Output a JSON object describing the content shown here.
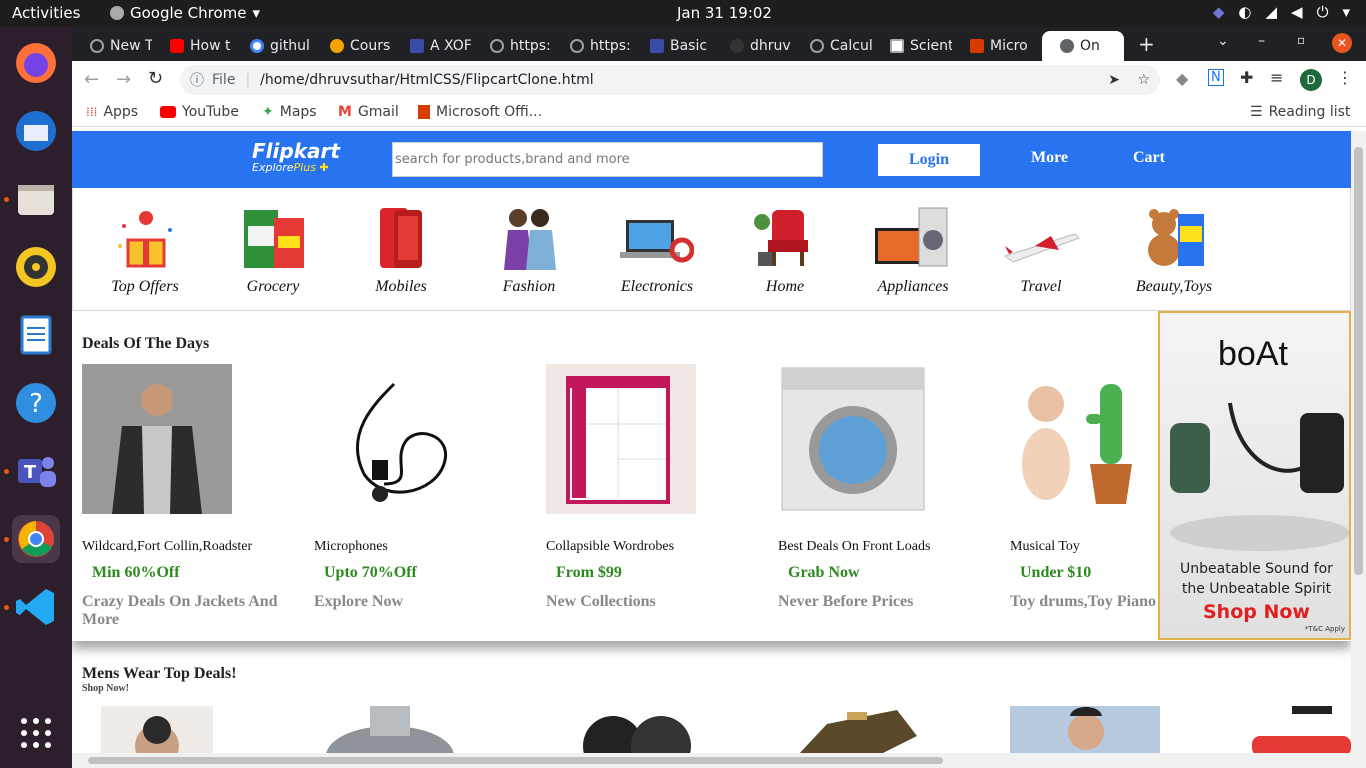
{
  "os": {
    "activities": "Activities",
    "app_name": "Google Chrome",
    "clock": "Jan 31  19:02"
  },
  "tabs": [
    {
      "label": "New T",
      "color": "#5f6368"
    },
    {
      "label": "How t",
      "color": "#ff0000"
    },
    {
      "label": "githul",
      "color": "#4285f4"
    },
    {
      "label": "Cours",
      "color": "#f4a300"
    },
    {
      "label": "A XOF",
      "color": "#3b4ba8"
    },
    {
      "label": "https:",
      "color": "#5f6368"
    },
    {
      "label": "https:",
      "color": "#5f6368"
    },
    {
      "label": "Basic",
      "color": "#3b4ba8"
    },
    {
      "label": "dhruv",
      "color": "#333333"
    },
    {
      "label": "Calcul",
      "color": "#5f6368"
    },
    {
      "label": "Scient",
      "color": "#aaaaaa"
    },
    {
      "label": "Micro",
      "color": "#d83b01"
    },
    {
      "label": "On",
      "color": "#5f6368"
    }
  ],
  "toolbar": {
    "file_label": "File",
    "url": "/home/dhruvsuthar/HtmlCSS/FlipcartClone.html",
    "profile_initial": "D"
  },
  "bookmarks": {
    "apps": "Apps",
    "youtube": "YouTube",
    "maps": "Maps",
    "gmail": "Gmail",
    "office": "Microsoft Offi...",
    "reading_list": "Reading list"
  },
  "header": {
    "logo": "Flipkart",
    "logo_sub_a": "Explore",
    "logo_sub_b": "Plus",
    "search_placeholder": "search for products,brand and more",
    "login": "Login",
    "more": "More",
    "cart": "Cart"
  },
  "categories": [
    {
      "label": "Top Offers",
      "icon": "gift-icon"
    },
    {
      "label": "Grocery",
      "icon": "grocery-icon"
    },
    {
      "label": "Mobiles",
      "icon": "phone-icon"
    },
    {
      "label": "Fashion",
      "icon": "fashion-icon"
    },
    {
      "label": "Electronics",
      "icon": "laptop-icon"
    },
    {
      "label": "Home",
      "icon": "chair-icon"
    },
    {
      "label": "Appliances",
      "icon": "tv-icon"
    },
    {
      "label": "Travel",
      "icon": "plane-icon"
    },
    {
      "label": "Beauty,Toys",
      "icon": "teddy-icon"
    }
  ],
  "deals": {
    "title": "Deals Of The Days",
    "items": [
      {
        "name": "Wildcard,Fort Collin,Roadster",
        "offer": "Min 60%Off",
        "sub": "Crazy Deals On Jackets And More"
      },
      {
        "name": "Microphones",
        "offer": "Upto 70%Off",
        "sub": "Explore Now"
      },
      {
        "name": "Collapsible Wordrobes",
        "offer": "From $99",
        "sub": "New Collections"
      },
      {
        "name": "Best Deals On Front Loads",
        "offer": "Grab Now",
        "sub": "Never Before Prices"
      },
      {
        "name": "Musical Toy",
        "offer": "Under $10",
        "sub": "Toy drums,Toy Piano"
      }
    ]
  },
  "ad": {
    "brand": "boAt",
    "line1": "Unbeatable Sound for",
    "line2": "the Unbeatable Spirit",
    "cta": "Shop Now",
    "tc": "*T&C Apply"
  },
  "mens": {
    "title": "Mens Wear Top Deals!",
    "sub": "Shop Now!"
  }
}
